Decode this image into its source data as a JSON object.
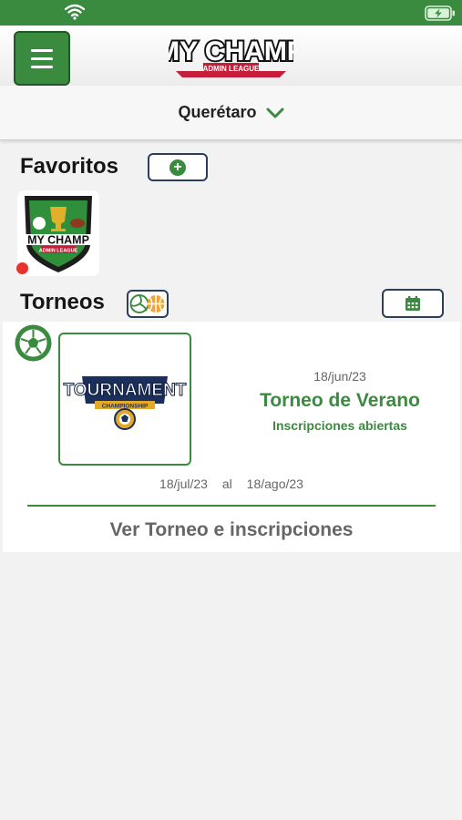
{
  "colors": {
    "accent": "#3a8a3f",
    "status_dot": "#e8322a",
    "border": "#2c3e5a"
  },
  "header": {
    "menu_icon": "hamburger-menu-icon",
    "logo": {
      "line1": "MY CHAMP",
      "line2": "ADMIN LEAGUE"
    }
  },
  "location": {
    "city": "Querétaro",
    "icon": "chevron-down-icon"
  },
  "favorites": {
    "title": "Favoritos",
    "add_icon": "plus-circle-icon",
    "items": [
      {
        "logo_line1": "MY CHAMP",
        "logo_line2": "ADMIN LEAGUE",
        "status": "red-dot"
      }
    ]
  },
  "tournaments": {
    "title": "Torneos",
    "filter_icons": [
      "volleyball-icon",
      "basketball-icon"
    ],
    "calendar_icon": "calendar-icon",
    "items": [
      {
        "sport_icon": "soccer-ball-icon",
        "logo_title": "TOURNAMENT",
        "logo_subtitle": "CHAMPIONSHIP",
        "registration_date": "18/jun/23",
        "name": "Torneo de Verano",
        "status": "Inscripciones abiertas",
        "start_date": "18/jul/23",
        "separator": "al",
        "end_date": "18/ago/23",
        "action_label": "Ver Torneo e inscripciones"
      }
    ]
  }
}
